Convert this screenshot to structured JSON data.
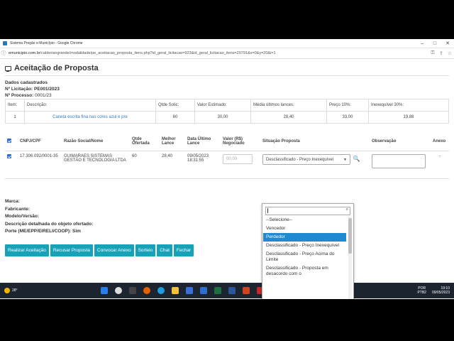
{
  "window": {
    "title": "Sistema Pregão e-Município - Google Chrome"
  },
  "address": {
    "domain": "emunicipio.com.br",
    "path": "/caldeiraogrande/modalidade/pe_aceitacao_proposta_itens.php?id_geral_licitacao=923&id_geral_licitacao_itens=29791&x=0&y=20&i=1"
  },
  "page": {
    "title": "Aceitação de Proposta",
    "dados_label": "Dados cadastrados",
    "licitacao_label": "Nº Licitação:",
    "licitacao_value": "PE001/2023",
    "processo_label": "Nº Processo:",
    "processo_value": "0001/23"
  },
  "item_table": {
    "headers": [
      "Item:",
      "Descrição:",
      "Qtde Solic:",
      "Valor Estimado:",
      "Média últimos lances:",
      "Preço 10%:",
      "Inexequível 30%:"
    ],
    "row": [
      "1",
      "Caneta escrita fina nas cores azul e pre",
      "60",
      "30,00",
      "28,40",
      "33,00",
      "19,88"
    ]
  },
  "bids_table": {
    "headers": {
      "cnpj": "CNPJ/CPF",
      "razao": "Razão Social/Nome",
      "qtde": "Qtde Ofertada",
      "melhor": "Melhor Lance",
      "data": "Data Último Lance",
      "valor": "Valor (R$) Negociado",
      "situacao": "Situação Proposta",
      "obs": "Observação",
      "anexo": "Anexo"
    },
    "row": {
      "cnpj": "17.306.092/0001-35",
      "razao": "GUIMARAES SISTEMAS GESTÃO E TECNOLOGIA LTDA",
      "qtde": "60",
      "melhor": "28,40",
      "data": "09/05/2023 18:31:55",
      "valor_placeholder": "00,00",
      "situacao": "Desclassificado - Preço Inexequível",
      "anexo": "-"
    }
  },
  "details": [
    "Marca:",
    "Fabricante:",
    "Modelo/Versão:",
    "Descrição detalhada do objeto ofertado:",
    "Porte (ME/EPP/EIRELI/COOP): Sim"
  ],
  "buttons": [
    "Realizar Aceitação",
    "Recusar Proposta",
    "Convocar Anexo",
    "Sorteio",
    "Chat",
    "Fechar"
  ],
  "dropdown": {
    "options": [
      "--Selecione--",
      "Vencedor",
      "Perdedor",
      "Desclassificado - Preço Inexequível",
      "Desclassificado - Preço Acima do Limite",
      "Desclassificado - Proposta em desacordo com o"
    ],
    "highlighted_index": 2
  },
  "taskbar": {
    "temperature": "28°",
    "lang1": "POR",
    "lang2": "PTB2",
    "time": "19:10",
    "date": "09/05/2023"
  }
}
